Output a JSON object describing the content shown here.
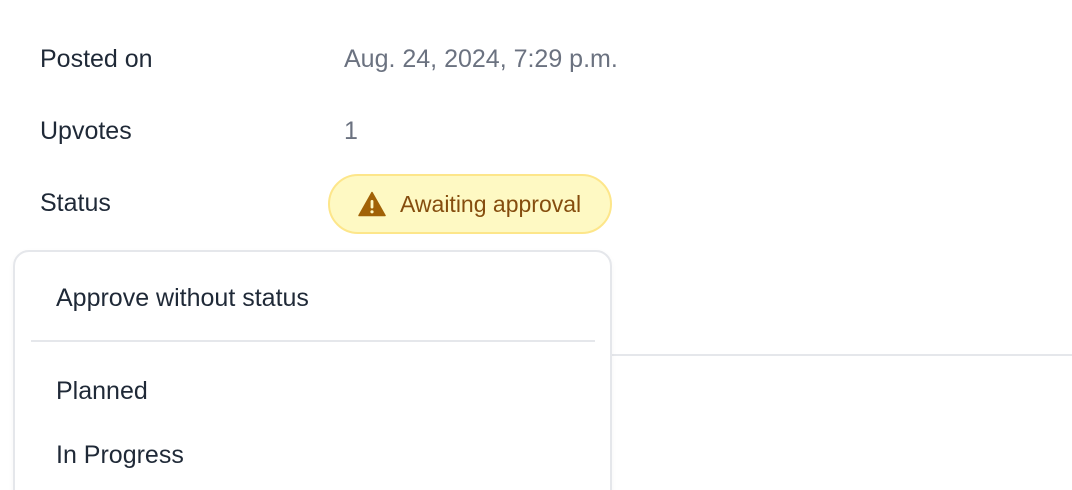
{
  "details": {
    "posted_on": {
      "label": "Posted on",
      "value": "Aug. 24, 2024, 7:29 p.m."
    },
    "upvotes": {
      "label": "Upvotes",
      "value": "1"
    },
    "status": {
      "label": "Status",
      "badge_text": "Awaiting approval",
      "badge_icon": "warning-triangle-icon",
      "badge_bg": "#fef9c3",
      "badge_border": "#fde68a",
      "badge_text_color": "#854d0e"
    }
  },
  "status_menu": {
    "items": [
      {
        "label": "Approve without status"
      },
      {
        "label": "Planned"
      },
      {
        "label": "In Progress"
      }
    ]
  }
}
